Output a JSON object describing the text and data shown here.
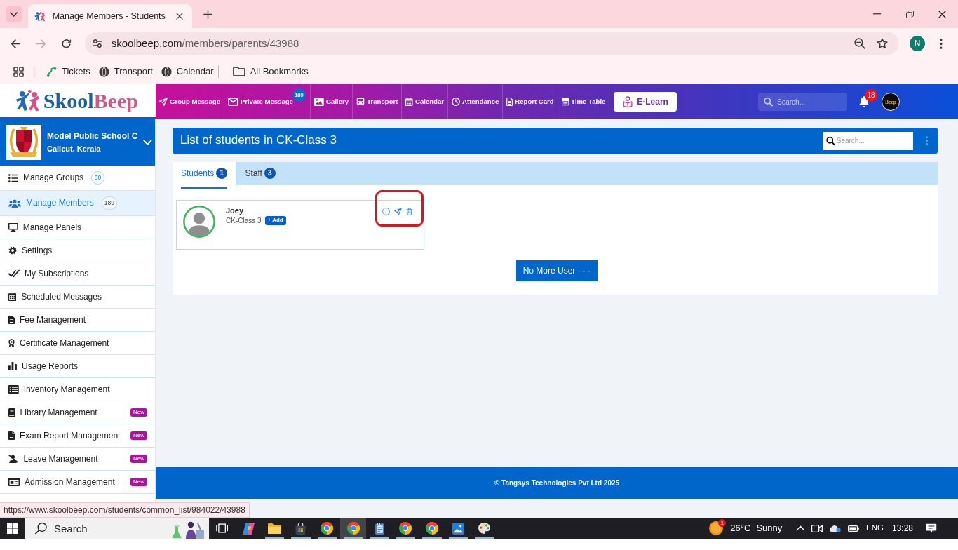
{
  "browser": {
    "tab": {
      "title": "Manage Members - Students",
      "selected": true
    },
    "nav_buttons": [
      {
        "kind": "back",
        "disabled": false
      },
      {
        "kind": "forward",
        "disabled": true
      },
      {
        "kind": "reload",
        "disabled": false
      }
    ],
    "address": {
      "host": "skoolbeep.com",
      "path": "/members/parents/43988"
    },
    "profile_initial": "N",
    "bookmarks": [
      {
        "kind": "tickets",
        "label": "Tickets"
      },
      {
        "kind": "globe",
        "label": "Transport"
      },
      {
        "kind": "globe",
        "label": "Calendar"
      }
    ],
    "all_bookmarks": "All Bookmarks"
  },
  "app_header": {
    "logo": {
      "first": "Skool",
      "second": "Beep"
    },
    "nav": [
      {
        "kind": "send",
        "label": "Group Message"
      },
      {
        "kind": "envelope",
        "label": "Private Message",
        "badge": "189"
      },
      {
        "kind": "image",
        "label": "Gallery"
      },
      {
        "kind": "bus",
        "label": "Transport"
      },
      {
        "kind": "calendar",
        "label": "Calendar"
      },
      {
        "kind": "clock",
        "label": "Attendance"
      },
      {
        "kind": "file",
        "label": "Report Card"
      },
      {
        "kind": "table",
        "label": "Time Table"
      }
    ],
    "elearn": "E-Learn",
    "search": {
      "placeholder": "Search..."
    },
    "notification_count": "18",
    "avatar_text": "Beep"
  },
  "sidebar": {
    "school": {
      "name": "Model Public School C",
      "location": "Calicut, Kerala"
    },
    "items": [
      {
        "kind": "list",
        "label": "Manage Groups",
        "count": "60",
        "selected": false
      },
      {
        "kind": "users",
        "label": "Manage Members",
        "count": "189",
        "selected": true
      },
      {
        "kind": "monitor",
        "label": "Manage Panels",
        "selected": false
      },
      {
        "kind": "gear",
        "label": "Settings",
        "selected": false
      },
      {
        "kind": "check",
        "label": "My Subscriptions",
        "selected": false
      },
      {
        "kind": "calgrid",
        "label": "Scheduled Messages",
        "selected": false
      },
      {
        "kind": "invoice",
        "label": "Fee Management",
        "selected": false
      },
      {
        "kind": "award",
        "label": "Certificate Management",
        "selected": false
      },
      {
        "kind": "bars",
        "label": "Usage Reports",
        "selected": false
      },
      {
        "kind": "listalt",
        "label": "Inventory Management",
        "selected": false
      },
      {
        "kind": "book",
        "label": "Library Management",
        "tag": "New",
        "selected": false
      },
      {
        "kind": "doc",
        "label": "Exam Report Management",
        "tag": "New",
        "selected": false
      },
      {
        "kind": "userslash",
        "label": "Leave Management",
        "tag": "New",
        "selected": false
      },
      {
        "kind": "idcard",
        "label": "Admission Management",
        "tag": "New",
        "selected": false
      }
    ]
  },
  "main": {
    "title": "List of students in CK-Class 3",
    "search": {
      "placeholder": "Search..."
    },
    "tabs": [
      {
        "label": "Students",
        "count": "1",
        "selected": true
      },
      {
        "label": "Staff",
        "count": "3",
        "selected": false
      }
    ],
    "members": [
      {
        "name": "Joey",
        "class": "CK-Class 3",
        "add": "+ Add",
        "actions_highlighted": true
      }
    ],
    "end_button": "No More User · · ·"
  },
  "footer": "© Tangsys Technologies Pvt Ltd 2025",
  "status_url": "https://www.skoolbeep.com/students/common_list/984022/43988",
  "taskbar": {
    "search": {
      "placeholder": "Search"
    },
    "apps": [
      {
        "kind": "task-view",
        "selected": false,
        "running": false
      },
      {
        "kind": "copilot",
        "selected": false,
        "running": false
      },
      {
        "kind": "explorer",
        "selected": false,
        "running": true
      },
      {
        "kind": "store",
        "selected": false,
        "running": true
      },
      {
        "kind": "chrome",
        "selected": false,
        "running": true
      },
      {
        "kind": "chrome",
        "selected": true,
        "running": true
      },
      {
        "kind": "notepad",
        "selected": false,
        "running": true
      },
      {
        "kind": "chrome",
        "selected": false,
        "running": true
      },
      {
        "kind": "chrome",
        "selected": false,
        "running": true
      },
      {
        "kind": "photos",
        "selected": false,
        "running": true
      },
      {
        "kind": "paint",
        "selected": false,
        "running": true
      }
    ],
    "weather": {
      "alerts": "1",
      "temperature": "26°C",
      "condition": "Sunny"
    },
    "language": "ENG",
    "time": "13:28"
  }
}
